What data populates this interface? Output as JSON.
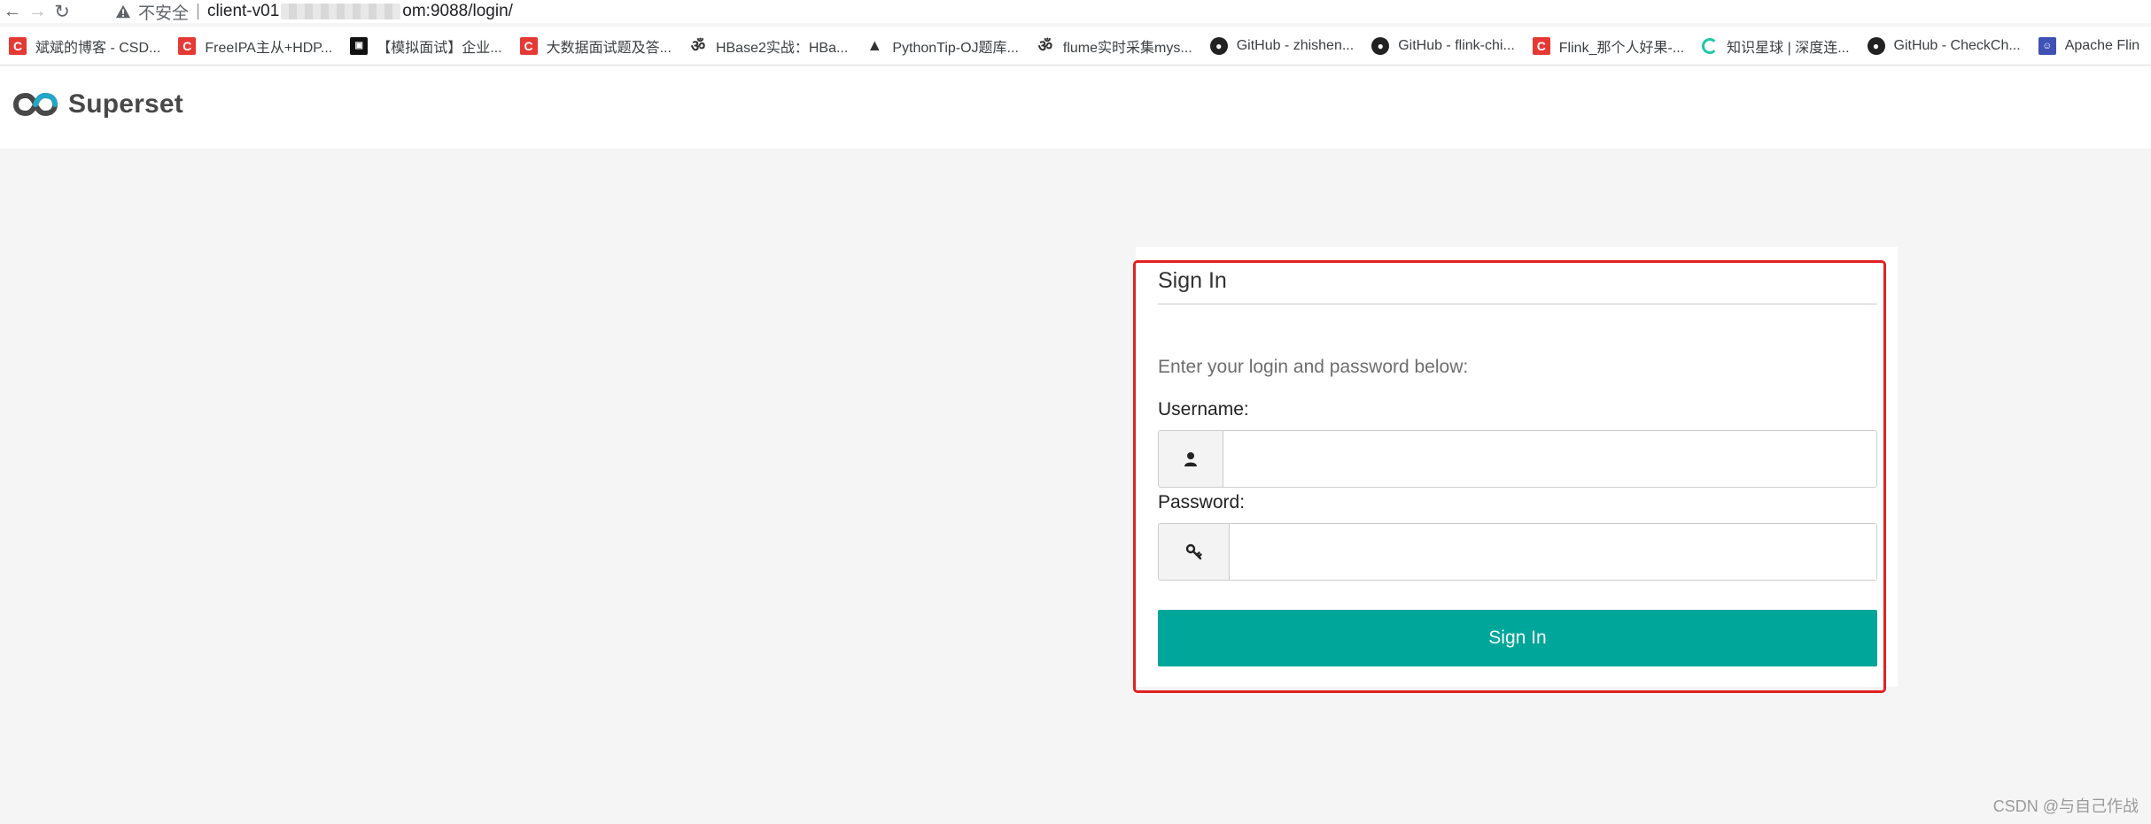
{
  "browser": {
    "security_label": "不安全",
    "url_prefix": "client-v01",
    "url_suffix": "om:9088/login/"
  },
  "bookmarks": [
    {
      "label": "斌斌的博客 - CSD...",
      "icon": "csdn-icon"
    },
    {
      "label": "FreeIPA主从+HDP...",
      "icon": "csdn-icon"
    },
    {
      "label": "【模拟面试】企业...",
      "icon": "site-icon"
    },
    {
      "label": "大数据面试题及答...",
      "icon": "csdn-icon"
    },
    {
      "label": "HBase2实战：HBa...",
      "icon": "glyph-icon"
    },
    {
      "label": "PythonTip-OJ题库...",
      "icon": "triangle-icon"
    },
    {
      "label": "flume实时采集mys...",
      "icon": "glyph-icon"
    },
    {
      "label": "GitHub - zhishen...",
      "icon": "github-icon"
    },
    {
      "label": "GitHub - flink-chi...",
      "icon": "github-icon"
    },
    {
      "label": "Flink_那个人好果-...",
      "icon": "csdn-icon"
    },
    {
      "label": "知识星球 | 深度连...",
      "icon": "zsxq-icon"
    },
    {
      "label": "GitHub - CheckCh...",
      "icon": "github-icon"
    },
    {
      "label": "Apache Flin",
      "icon": "avatar-icon"
    }
  ],
  "app": {
    "brand": "Superset"
  },
  "login": {
    "title": "Sign In",
    "prompt": "Enter your login and password below:",
    "username_label": "Username:",
    "password_label": "Password:",
    "username_value": "",
    "password_value": "",
    "submit_label": "Sign In"
  },
  "colors": {
    "primary": "#00a699",
    "highlight": "#e02222",
    "brand_text": "#484848"
  },
  "watermark": "CSDN @与自己作战"
}
